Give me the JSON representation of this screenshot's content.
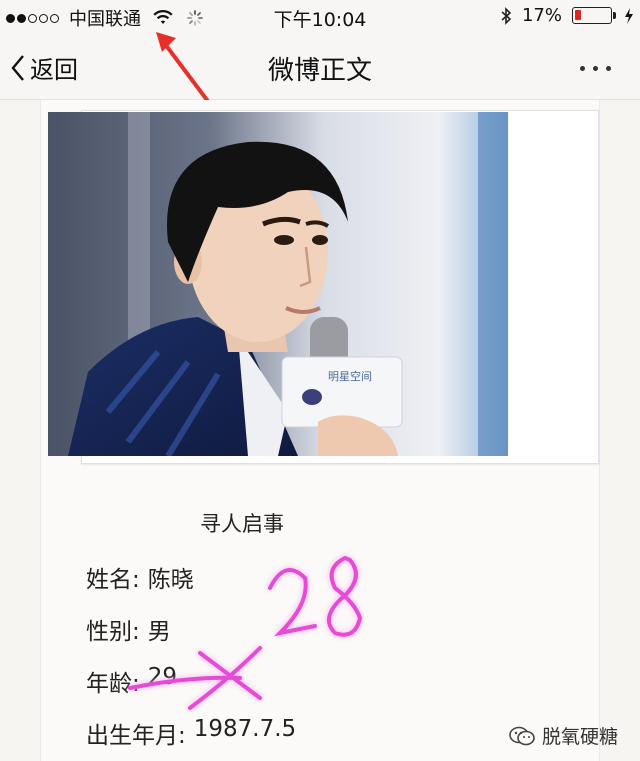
{
  "status_bar": {
    "carrier": "中国联通",
    "time": "下午10:04",
    "battery_percent_label": "17%",
    "battery_level": 0.17,
    "signal_filled": 2,
    "signal_total": 5,
    "colors": {
      "battery_low": "#e0271f"
    }
  },
  "nav": {
    "back_label": "返回",
    "title": "微博正文",
    "icons": [
      "chevron-left-icon",
      "more-dots-icon"
    ]
  },
  "post": {
    "mic_brand": "明星空间",
    "notice_title": "寻人启事",
    "fields": [
      {
        "label": "姓名:",
        "value": "陈晓"
      },
      {
        "label": "性别:",
        "value": "男"
      },
      {
        "label": "年龄:",
        "value": "29"
      },
      {
        "label": "出生年月:",
        "value": "1987.7.5"
      }
    ],
    "handwritten_note": "×28",
    "handwriting_color": "#e64bd6"
  },
  "watermark": {
    "text": "脱氧硬糖",
    "icon": "wechat-icon"
  },
  "annotation": {
    "arrow_color": "#e4322b"
  }
}
